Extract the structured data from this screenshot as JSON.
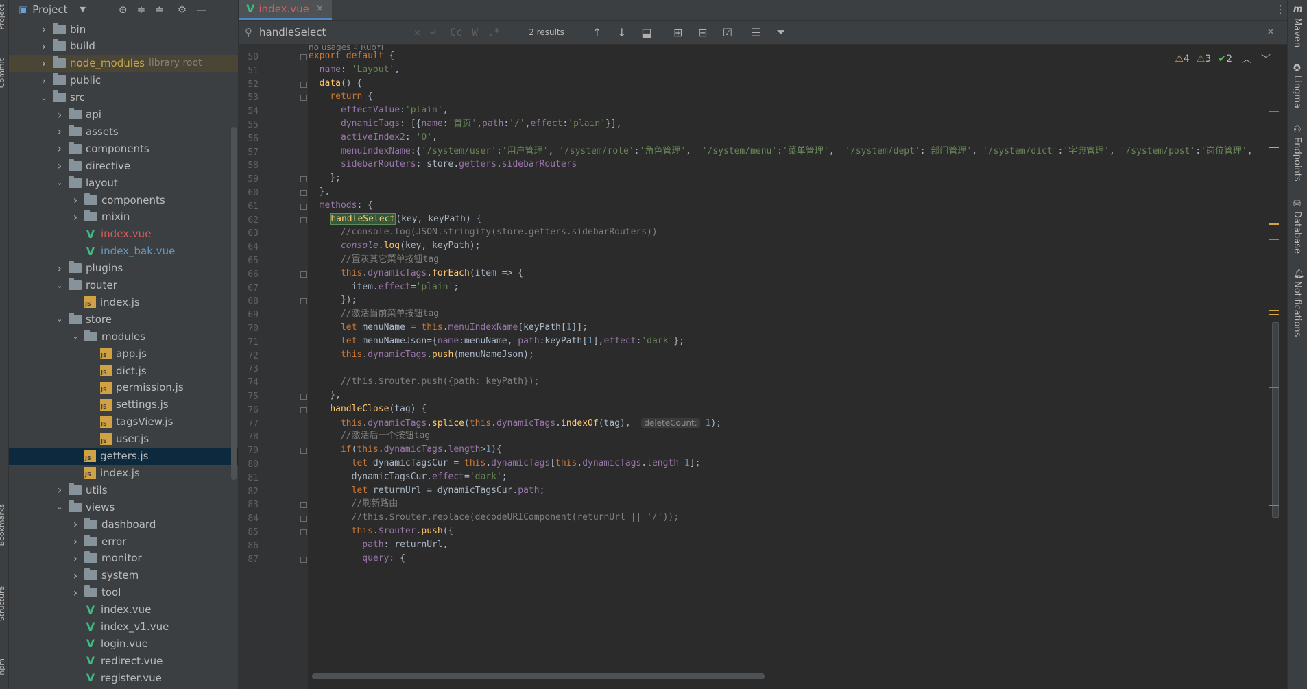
{
  "project_panel": {
    "title": "Project",
    "tree": [
      {
        "label": "bin",
        "type": "folder",
        "depth": 2,
        "expanded": false
      },
      {
        "label": "build",
        "type": "folder",
        "depth": 2,
        "expanded": false
      },
      {
        "label": "node_modules",
        "hint": "library root",
        "type": "folder",
        "depth": 2,
        "expanded": false,
        "style": "lib"
      },
      {
        "label": "public",
        "type": "folder",
        "depth": 2,
        "expanded": false
      },
      {
        "label": "src",
        "type": "folder",
        "depth": 2,
        "expanded": true
      },
      {
        "label": "api",
        "type": "folder",
        "depth": 3,
        "expanded": false
      },
      {
        "label": "assets",
        "type": "folder",
        "depth": 3,
        "expanded": false
      },
      {
        "label": "components",
        "type": "folder",
        "depth": 3,
        "expanded": false
      },
      {
        "label": "directive",
        "type": "folder",
        "depth": 3,
        "expanded": false
      },
      {
        "label": "layout",
        "type": "folder",
        "depth": 3,
        "expanded": true
      },
      {
        "label": "components",
        "type": "folder",
        "depth": 4,
        "expanded": false
      },
      {
        "label": "mixin",
        "type": "folder",
        "depth": 4,
        "expanded": false
      },
      {
        "label": "index.vue",
        "type": "vue",
        "depth": 4,
        "color": "red"
      },
      {
        "label": "index_bak.vue",
        "type": "vue",
        "depth": 4,
        "color": "blue"
      },
      {
        "label": "plugins",
        "type": "folder",
        "depth": 3,
        "expanded": false
      },
      {
        "label": "router",
        "type": "folder",
        "depth": 3,
        "expanded": true
      },
      {
        "label": "index.js",
        "type": "js",
        "depth": 4
      },
      {
        "label": "store",
        "type": "folder",
        "depth": 3,
        "expanded": true
      },
      {
        "label": "modules",
        "type": "folder",
        "depth": 4,
        "expanded": true
      },
      {
        "label": "app.js",
        "type": "js",
        "depth": 5
      },
      {
        "label": "dict.js",
        "type": "js",
        "depth": 5
      },
      {
        "label": "permission.js",
        "type": "js",
        "depth": 5
      },
      {
        "label": "settings.js",
        "type": "js",
        "depth": 5
      },
      {
        "label": "tagsView.js",
        "type": "js",
        "depth": 5
      },
      {
        "label": "user.js",
        "type": "js",
        "depth": 5
      },
      {
        "label": "getters.js",
        "type": "js",
        "depth": 4,
        "style": "sel"
      },
      {
        "label": "index.js",
        "type": "js",
        "depth": 4
      },
      {
        "label": "utils",
        "type": "folder",
        "depth": 3,
        "expanded": false
      },
      {
        "label": "views",
        "type": "folder",
        "depth": 3,
        "expanded": true
      },
      {
        "label": "dashboard",
        "type": "folder",
        "depth": 4,
        "expanded": false
      },
      {
        "label": "error",
        "type": "folder",
        "depth": 4,
        "expanded": false
      },
      {
        "label": "monitor",
        "type": "folder",
        "depth": 4,
        "expanded": false
      },
      {
        "label": "system",
        "type": "folder",
        "depth": 4,
        "expanded": false
      },
      {
        "label": "tool",
        "type": "folder",
        "depth": 4,
        "expanded": false
      },
      {
        "label": "index.vue",
        "type": "vue",
        "depth": 4
      },
      {
        "label": "index_v1.vue",
        "type": "vue",
        "depth": 4
      },
      {
        "label": "login.vue",
        "type": "vue",
        "depth": 4
      },
      {
        "label": "redirect.vue",
        "type": "vue",
        "depth": 4
      },
      {
        "label": "register.vue",
        "type": "vue",
        "depth": 4
      }
    ]
  },
  "left_strip": {
    "labels": [
      "Project",
      "Commit",
      "Bookmarks",
      "Structure",
      "npm"
    ]
  },
  "editor": {
    "tab": {
      "label": "index.vue",
      "close": "×"
    },
    "find": {
      "query": "handleSelect",
      "results": "2 results",
      "opts": [
        "Cc",
        "W",
        ".*"
      ]
    },
    "usage_hint": "no usages   ⍨ RuoYi",
    "inspections": {
      "warnings": "4",
      "weak_warnings": "3",
      "ok": "2"
    },
    "inlay_hint": "deleteCount:",
    "code": [
      {
        "n": "50",
        "fold": true,
        "html": "<span class=\"kw\">export default</span> {"
      },
      {
        "n": "51",
        "html": "  <span class=\"prop\">name</span>: <span class=\"str\">'Layout'</span>,"
      },
      {
        "n": "52",
        "fold": true,
        "html": "  <span class=\"fn\">data</span>() {"
      },
      {
        "n": "53",
        "fold": true,
        "html": "    <span class=\"kw\">return</span> {"
      },
      {
        "n": "54",
        "html": "      <span class=\"prop\">effectValue</span>:<span class=\"str\">'plain'</span>,"
      },
      {
        "n": "55",
        "html": "      <span class=\"prop\">dynamicTags</span>: [{<span class=\"prop\">name</span>:<span class=\"str\">'首页'</span>,<span class=\"prop\">path</span>:<span class=\"str\">'/'</span>,<span class=\"prop\">effect</span>:<span class=\"str\">'plain'</span>}],"
      },
      {
        "n": "56",
        "html": "      <span class=\"prop\">activeIndex2</span>: <span class=\"str\">'0'</span>,"
      },
      {
        "n": "57",
        "html": "      <span class=\"prop\">menuIndexName</span>:{<span class=\"str\">'/system/user'</span>:<span class=\"str\">'用户管理'</span>, <span class=\"str\">'/system/role'</span>:<span class=\"str\">'角色管理'</span>,  <span class=\"str\">'/system/menu'</span>:<span class=\"str\">'菜单管理'</span>,  <span class=\"str\">'/system/dept'</span>:<span class=\"str\">'部门管理'</span>, <span class=\"str\">'/system/dict'</span>:<span class=\"str\">'字典管理'</span>, <span class=\"str\">'/system/post'</span>:<span class=\"str\">'岗位管理'</span>,"
      },
      {
        "n": "58",
        "html": "      <span class=\"prop\">sidebarRouters</span>: store.<span class=\"prop\">getters</span>.<span class=\"prop\">sidebarRouters</span>"
      },
      {
        "n": "59",
        "fold": true,
        "html": "    };"
      },
      {
        "n": "60",
        "fold": true,
        "html": "  },"
      },
      {
        "n": "61",
        "fold": true,
        "html": "  <span class=\"prop\">methods</span>: {"
      },
      {
        "n": "62",
        "fold": true,
        "html": "    <span class=\"fn hl\">handleSelect</span>(key, keyPath) {"
      },
      {
        "n": "63",
        "html": "      <span class=\"cmt\">//console.log(JSON.stringify(store.getters.sidebarRouters))</span>"
      },
      {
        "n": "64",
        "html": "      <span class=\"ital\">console</span>.<span class=\"fn\">log</span>(key, keyPath);"
      },
      {
        "n": "65",
        "html": "      <span class=\"cmt\">//置灰其它菜单按钮tag</span>"
      },
      {
        "n": "66",
        "fold": true,
        "html": "      <span class=\"kw\">this</span>.<span class=\"prop\">dynamicTags</span>.<span class=\"fn\">forEach</span>(item => {"
      },
      {
        "n": "67",
        "html": "        item.<span class=\"prop\">effect</span>=<span class=\"str\">'plain'</span>;"
      },
      {
        "n": "68",
        "fold": true,
        "html": "      });"
      },
      {
        "n": "69",
        "html": "      <span class=\"cmt\">//激活当前菜单按钮tag</span>"
      },
      {
        "n": "70",
        "html": "      <span class=\"kw\">let</span> menuName = <span class=\"kw\">this</span>.<span class=\"prop\">menuIndexName</span>[keyPath[<span class=\"num\">1</span>]];"
      },
      {
        "n": "71",
        "html": "      <span class=\"kw\">let</span> menuNameJson={<span class=\"prop\">name</span>:menuName, <span class=\"prop\">path</span>:keyPath[<span class=\"num\">1</span>],<span class=\"prop\">effect</span>:<span class=\"str\">'dark'</span>};"
      },
      {
        "n": "72",
        "html": "      <span class=\"kw\">this</span>.<span class=\"prop\">dynamicTags</span>.<span class=\"fn\">push</span>(menuNameJson);"
      },
      {
        "n": "73",
        "html": ""
      },
      {
        "n": "74",
        "html": "      <span class=\"cmt\">//this.$router.push({path: keyPath});</span>"
      },
      {
        "n": "75",
        "fold": true,
        "html": "    },"
      },
      {
        "n": "76",
        "fold": true,
        "html": "    <span class=\"fn\">handleClose</span>(tag) {"
      },
      {
        "n": "77",
        "html": "      <span class=\"kw\">this</span>.<span class=\"prop\">dynamicTags</span>.<span class=\"fn\">splice</span>(<span class=\"kw\">this</span>.<span class=\"prop\">dynamicTags</span>.<span class=\"fn\">indexOf</span>(tag),  <span class=\"inlay\">deleteCount:</span> <span class=\"num\">1</span>);"
      },
      {
        "n": "78",
        "html": "      <span class=\"cmt\">//激活后一个按钮tag</span>"
      },
      {
        "n": "79",
        "fold": true,
        "html": "      <span class=\"kw\">if</span>(<span class=\"kw\">this</span>.<span class=\"prop\">dynamicTags</span>.<span class=\"prop\">length</span>><span class=\"num\">1</span>){"
      },
      {
        "n": "80",
        "html": "        <span class=\"kw\">let</span> dynamicTagsCur = <span class=\"kw\">this</span>.<span class=\"prop\">dynamicTags</span>[<span class=\"kw\">this</span>.<span class=\"prop\">dynamicTags</span>.<span class=\"prop\">length</span>-<span class=\"num\">1</span>];"
      },
      {
        "n": "81",
        "html": "        dynamicTagsCur.<span class=\"prop\">effect</span>=<span class=\"str\">'dark'</span>;"
      },
      {
        "n": "82",
        "html": "        <span class=\"kw\">let</span> returnUrl = dynamicTagsCur.<span class=\"prop\">path</span>;"
      },
      {
        "n": "83",
        "fold": true,
        "html": "        <span class=\"cmt\">//刷新路由</span>"
      },
      {
        "n": "84",
        "fold": true,
        "html": "        <span class=\"cmt\">//this.$router.replace(decodeURIComponent(returnUrl || '/'));</span>"
      },
      {
        "n": "85",
        "fold": true,
        "html": "        <span class=\"kw\">this</span>.<span class=\"prop\">$router</span>.<span class=\"fn\">push</span>({"
      },
      {
        "n": "86",
        "html": "          <span class=\"prop\">path</span>: returnUrl,"
      },
      {
        "n": "87",
        "fold": true,
        "html": "          <span class=\"prop\">query</span>: {"
      }
    ]
  },
  "right_strip": {
    "labels": [
      "Maven",
      "Lingma",
      "Endpoints",
      "Database",
      "Notifications"
    ]
  },
  "colors": {
    "accent": "#4a88c7",
    "bg": "#2b2b2b",
    "panel": "#3c3f41",
    "selection": "#0d293e",
    "vue": "#41b883",
    "warning": "#e8a33e"
  }
}
